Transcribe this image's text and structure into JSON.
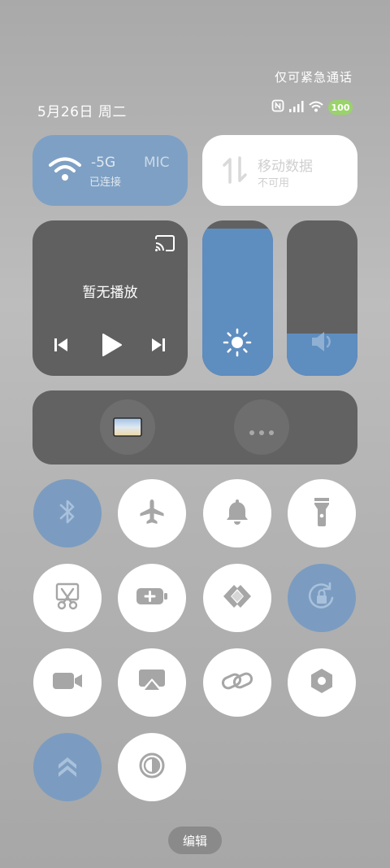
{
  "status_bar": {
    "emergency_text": "仅可紧急通话",
    "date_text": "5月26日 周二",
    "battery_level": "100",
    "icons": [
      "nfc-icon",
      "signal-icon",
      "wifi-icon",
      "battery-icon"
    ]
  },
  "wifi_tile": {
    "title": "-5G",
    "title_extra": "MIC",
    "subtitle": "已连接",
    "active": true
  },
  "mobile_data_tile": {
    "title": "移动数据",
    "subtitle": "不可用",
    "active": false
  },
  "media": {
    "status_text": "暂无播放"
  },
  "sliders": {
    "brightness": {
      "level": 0.95,
      "icon": "sun-icon"
    },
    "volume": {
      "level": 0.27,
      "icon": "speaker-icon"
    }
  },
  "wide_tile": {
    "icons": [
      "screen-thumbnail-icon",
      "more-icon"
    ]
  },
  "toggles": [
    {
      "name": "bluetooth",
      "icon": "bluetooth-icon",
      "active": true
    },
    {
      "name": "airplane-mode",
      "icon": "airplane-icon",
      "active": false
    },
    {
      "name": "sound",
      "icon": "bell-icon",
      "active": false
    },
    {
      "name": "flashlight",
      "icon": "flashlight-icon",
      "active": false
    },
    {
      "name": "screenshot",
      "icon": "scissors-icon",
      "active": false
    },
    {
      "name": "battery-saver",
      "icon": "battery-plus-icon",
      "active": false
    },
    {
      "name": "nearby-share",
      "icon": "share-diamond-icon",
      "active": false
    },
    {
      "name": "rotation-lock",
      "icon": "rotation-lock-icon",
      "active": true
    },
    {
      "name": "screen-record",
      "icon": "video-camera-icon",
      "active": false
    },
    {
      "name": "cast",
      "icon": "cast-screen-icon",
      "active": false
    },
    {
      "name": "link",
      "icon": "link-icon",
      "active": false
    },
    {
      "name": "settings",
      "icon": "hexagon-gear-icon",
      "active": false
    },
    {
      "name": "boost",
      "icon": "double-chevron-up-icon",
      "active": true
    },
    {
      "name": "dark-mode",
      "icon": "contrast-icon",
      "active": false
    }
  ],
  "edit_label": "编辑",
  "colors": {
    "active_blue": "#7b9cc0",
    "slider_fill": "#5e8dbf",
    "tile_dark": "#606060",
    "battery_green": "#9ad36a"
  }
}
